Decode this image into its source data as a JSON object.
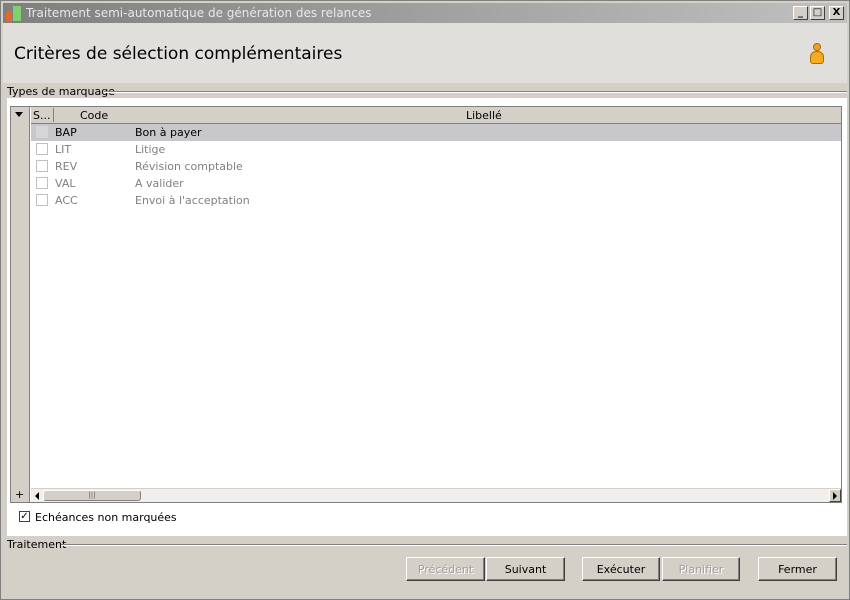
{
  "window": {
    "title": "Traitement semi-automatique de génération des relances",
    "minimize": "_",
    "maximize": "□",
    "close": "X"
  },
  "header": {
    "title": "Critères de sélection complémentaires",
    "icon": "user-icon"
  },
  "types_group": {
    "label": "Types de marquage",
    "columns": [
      "S...",
      "Code",
      "Libellé"
    ],
    "rows": [
      {
        "code": "BAP",
        "libelle": "Bon à payer",
        "selected": true
      },
      {
        "code": "LIT",
        "libelle": "Litige",
        "selected": false
      },
      {
        "code": "REV",
        "libelle": "Révision comptable",
        "selected": false
      },
      {
        "code": "VAL",
        "libelle": "A valider",
        "selected": false
      },
      {
        "code": "ACC",
        "libelle": "Envoi à l'acceptation",
        "selected": false
      }
    ],
    "add_symbol": "+",
    "scroll_thumb_grip": "|||"
  },
  "echeances": {
    "label": "Echéances non marquées",
    "checked": true,
    "check_mark": "✓"
  },
  "traitement_group": {
    "label": "Traitement"
  },
  "buttons": {
    "precedent": "Précédent",
    "suivant": "Suivant",
    "executer": "Exécuter",
    "planifier": "Planifier",
    "fermer": "Fermer"
  }
}
